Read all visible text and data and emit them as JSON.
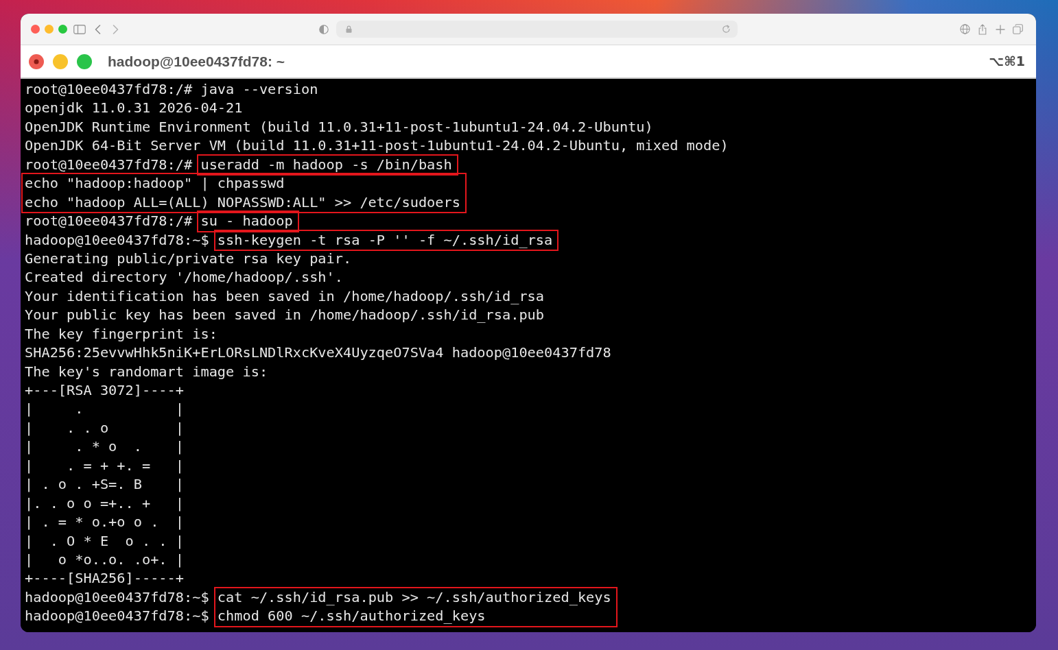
{
  "terminal_window": {
    "title": "hadoop@10ee0437fd78: ~",
    "shortcut": "⌥⌘1"
  },
  "terminal": {
    "blocks": [
      {
        "highlighted": false,
        "lines": [
          {
            "prompt": "root@10ee0437fd78:/#",
            "text": "java --version"
          },
          {
            "text": "openjdk 11.0.31 2026-04-21"
          },
          {
            "text": "OpenJDK Runtime Environment (build 11.0.31+11-post-1ubuntu1-24.04.2-Ubuntu)"
          },
          {
            "text": "OpenJDK 64-Bit Server VM (build 11.0.31+11-post-1ubuntu1-24.04.2-Ubuntu, mixed mode)"
          }
        ]
      },
      {
        "highlighted": true,
        "lines": [
          {
            "prompt": "root@10ee0437fd78:/#",
            "text": "useradd -m hadoop -s /bin/bash"
          }
        ]
      },
      {
        "highlighted": true,
        "lines": [
          {
            "text": "echo \"hadoop:hadoop\" | chpasswd"
          },
          {
            "text": "echo \"hadoop ALL=(ALL) NOPASSWD:ALL\" >> /etc/sudoers"
          }
        ]
      },
      {
        "highlighted": true,
        "lines": [
          {
            "prompt": "root@10ee0437fd78:/#",
            "text": "su - hadoop"
          }
        ]
      },
      {
        "highlighted": true,
        "lines": [
          {
            "prompt": "hadoop@10ee0437fd78:~$",
            "text": "ssh-keygen -t rsa -P '' -f ~/.ssh/id_rsa"
          }
        ]
      },
      {
        "highlighted": false,
        "lines": [
          {
            "text": "Generating public/private rsa key pair."
          },
          {
            "text": "Created directory '/home/hadoop/.ssh'."
          },
          {
            "text": "Your identification has been saved in /home/hadoop/.ssh/id_rsa"
          },
          {
            "text": "Your public key has been saved in /home/hadoop/.ssh/id_rsa.pub"
          },
          {
            "text": "The key fingerprint is:"
          },
          {
            "text": "SHA256:25evvwHhk5niK+ErLORsLNDlRxcKveX4UyzqeO7SVa4 hadoop@10ee0437fd78"
          },
          {
            "text": "The key's randomart image is:"
          },
          {
            "text": "+---[RSA 3072]----+"
          },
          {
            "text": "|     .           |"
          },
          {
            "text": "|    . . o        |"
          },
          {
            "text": "|     . * o  .    |"
          },
          {
            "text": "|    . = + +. =   |"
          },
          {
            "text": "| . o . +S=. B    |"
          },
          {
            "text": "|. . o o =+.. +   |"
          },
          {
            "text": "| . = * o.+o o .  |"
          },
          {
            "text": "|  . O * E  o . . |"
          },
          {
            "text": "|   o *o..o. .o+. |"
          },
          {
            "text": "+----[SHA256]-----+"
          }
        ]
      },
      {
        "highlighted": true,
        "lines": [
          {
            "prompt": "hadoop@10ee0437fd78:~$",
            "text": "cat ~/.ssh/id_rsa.pub >> ~/.ssh/authorized_keys"
          },
          {
            "prompt": "hadoop@10ee0437fd78:~$",
            "text": "chmod 600 ~/.ssh/authorized_keys"
          }
        ]
      }
    ]
  }
}
